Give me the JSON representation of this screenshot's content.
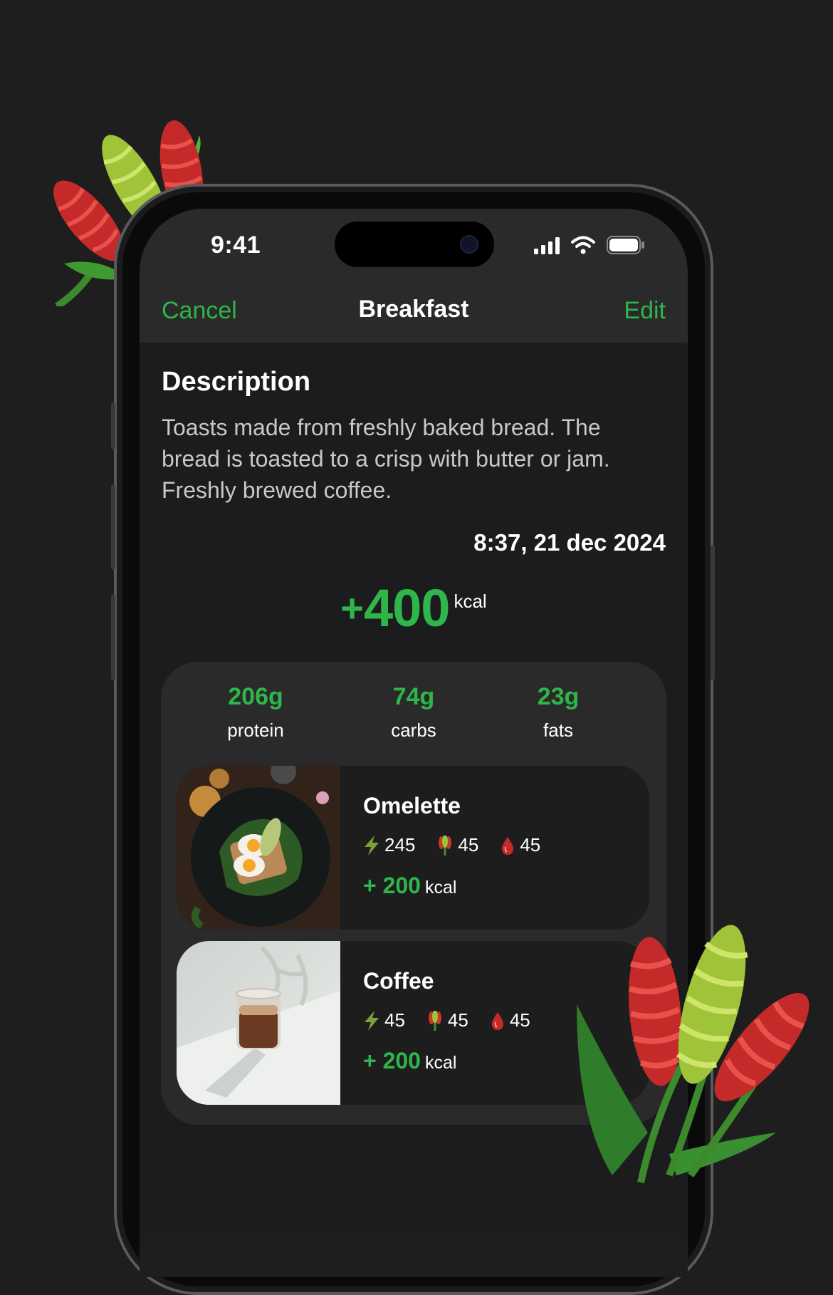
{
  "status_bar": {
    "time": "9:41"
  },
  "nav": {
    "cancel": "Cancel",
    "title": "Breakfast",
    "edit": "Edit"
  },
  "description": {
    "heading": "Description",
    "text": "Toasts made from freshly baked bread. The bread is toasted to a crisp with butter or jam. Freshly brewed coffee."
  },
  "meal_time": "8:37, 21 dec 2024",
  "total": {
    "plus": "+",
    "value": "400",
    "unit": "kcal"
  },
  "macros": [
    {
      "value": "206g",
      "label": "protein"
    },
    {
      "value": "74g",
      "label": "carbs"
    },
    {
      "value": "23g",
      "label": "fats"
    }
  ],
  "items": [
    {
      "name": "Omelette",
      "stats": [
        "245",
        "45",
        "45"
      ],
      "plus": "+",
      "kcal": "200",
      "unit": "kcal"
    },
    {
      "name": "Coffee",
      "stats": [
        "45",
        "45",
        "45"
      ],
      "plus": "+",
      "kcal": "200",
      "unit": "kcal"
    }
  ],
  "colors": {
    "accent": "#2fb64a",
    "background": "#1e1e1e",
    "card": "#2a2a2a",
    "item_card": "#1d1d1d"
  },
  "icons": [
    "lightning-icon",
    "wheat-icon",
    "drop-icon",
    "signal-icon",
    "wifi-icon",
    "battery-icon"
  ]
}
